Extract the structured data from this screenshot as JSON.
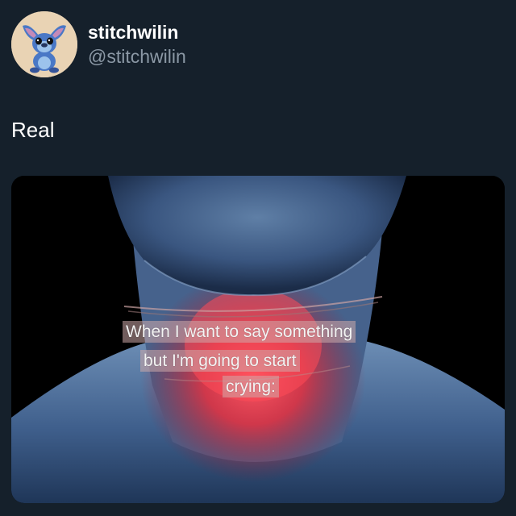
{
  "user": {
    "display_name": "stitchwilin",
    "handle": "@stitchwilin",
    "avatar_icon": "stitch-avatar-icon"
  },
  "post": {
    "text": "Real"
  },
  "media": {
    "caption_lines": [
      "When I want to say something",
      "but I'm going to start",
      "crying:"
    ]
  },
  "colors": {
    "background": "#15202b",
    "handle": "#8b98a5",
    "avatar_bg": "#e9d3b4",
    "throat_glow": "#ff3344"
  }
}
